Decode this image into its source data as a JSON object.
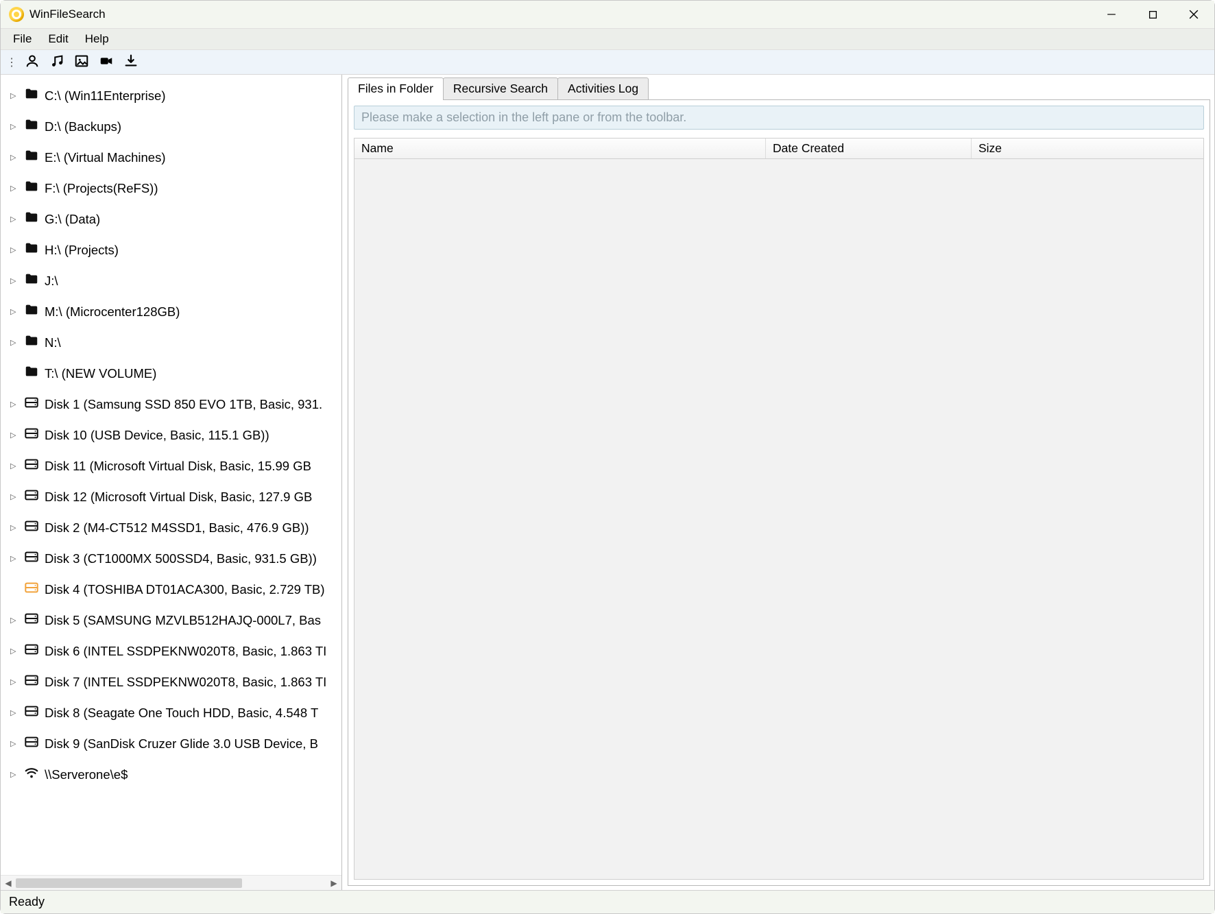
{
  "window": {
    "title": "WinFileSearch"
  },
  "menus": {
    "file": "File",
    "edit": "Edit",
    "help": "Help"
  },
  "tabs": {
    "files": "Files in Folder",
    "recursive": "Recursive Search",
    "activities": "Activities Log"
  },
  "hint": "Please make a selection in the left pane or from the toolbar.",
  "columns": {
    "name": "Name",
    "date": "Date Created",
    "size": "Size"
  },
  "status": "Ready",
  "tree": [
    {
      "type": "folder",
      "expander": true,
      "label": "C:\\ (Win11Enterprise)"
    },
    {
      "type": "folder",
      "expander": true,
      "label": "D:\\ (Backups)"
    },
    {
      "type": "folder",
      "expander": true,
      "label": "E:\\ (Virtual Machines)"
    },
    {
      "type": "folder",
      "expander": true,
      "label": "F:\\ (Projects(ReFS))"
    },
    {
      "type": "folder",
      "expander": true,
      "label": "G:\\ (Data)"
    },
    {
      "type": "folder",
      "expander": true,
      "label": "H:\\ (Projects)"
    },
    {
      "type": "folder",
      "expander": true,
      "label": "J:\\"
    },
    {
      "type": "folder",
      "expander": true,
      "label": "M:\\ (Microcenter128GB)"
    },
    {
      "type": "folder",
      "expander": true,
      "label": "N:\\"
    },
    {
      "type": "folder",
      "expander": false,
      "label": "T:\\ (NEW VOLUME)"
    },
    {
      "type": "disk",
      "expander": true,
      "label": "Disk 1 (Samsung SSD 850 EVO 1TB, Basic, 931."
    },
    {
      "type": "disk",
      "expander": true,
      "label": "Disk 10 (USB Device, Basic, 115.1 GB))"
    },
    {
      "type": "disk",
      "expander": true,
      "label": "Disk 11 (Microsoft Virtual Disk, Basic, 15.99 GB"
    },
    {
      "type": "disk",
      "expander": true,
      "label": "Disk 12 (Microsoft Virtual Disk, Basic, 127.9 GB"
    },
    {
      "type": "disk",
      "expander": true,
      "label": "Disk 2 (M4-CT512 M4SSD1, Basic, 476.9 GB))"
    },
    {
      "type": "disk",
      "expander": true,
      "label": "Disk 3 (CT1000MX 500SSD4, Basic, 931.5 GB))"
    },
    {
      "type": "disk-warn",
      "expander": false,
      "label": "Disk 4 (TOSHIBA DT01ACA300, Basic, 2.729 TB)"
    },
    {
      "type": "disk",
      "expander": true,
      "label": "Disk 5 (SAMSUNG MZVLB512HAJQ-000L7, Bas"
    },
    {
      "type": "disk",
      "expander": true,
      "label": "Disk 6 (INTEL SSDPEKNW020T8, Basic, 1.863 TI"
    },
    {
      "type": "disk",
      "expander": true,
      "label": "Disk 7 (INTEL SSDPEKNW020T8, Basic, 1.863 TI"
    },
    {
      "type": "disk",
      "expander": true,
      "label": "Disk 8 (Seagate One Touch HDD, Basic, 4.548 T"
    },
    {
      "type": "disk",
      "expander": true,
      "label": "Disk 9 (SanDisk Cruzer Glide 3.0 USB Device, B"
    },
    {
      "type": "network",
      "expander": true,
      "label": "\\\\Serverone\\e$"
    }
  ]
}
